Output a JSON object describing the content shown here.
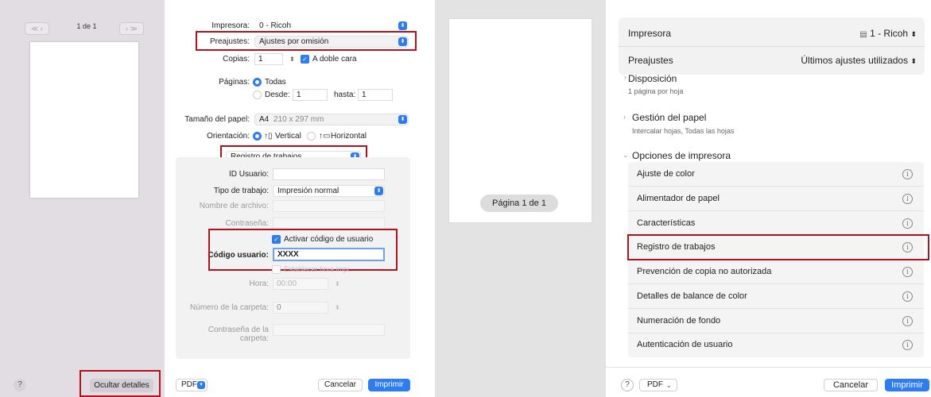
{
  "left_dialog": {
    "page_counter": "1 de 1",
    "printer": {
      "label": "Impresora:",
      "value": "0 - Ricoh"
    },
    "presets": {
      "label": "Preajustes:",
      "value": "Ajustes por omisión"
    },
    "copies": {
      "label": "Copias:",
      "value": "1",
      "two_sided_label": "A doble cara"
    },
    "pages": {
      "label": "Páginas:",
      "all_label": "Todas",
      "from_label": "Desde:",
      "from_value": "1",
      "to_label": "hasta:",
      "to_value": "1"
    },
    "paper_size": {
      "label": "Tamaño del papel:",
      "value": "A4",
      "dims": "210 x 297 mm"
    },
    "orientation": {
      "label": "Orientación:",
      "vertical": "Vertical",
      "horizontal": "Horizontal"
    },
    "section_popup": "Registro de trabajos",
    "job_log": {
      "user_id_label": "ID Usuario:",
      "job_type_label": "Tipo de trabajo:",
      "job_type_value": "Impresión normal",
      "file_name_label": "Nombre de archivo:",
      "password_label": "Contraseña:",
      "enable_user_code_label": "Activar código de usuario",
      "user_code_label": "Código usuario:",
      "user_code_value": "XXXX",
      "set_time_label": "Establecer hora impr.",
      "time_label": "Hora:",
      "time_value": "00:00",
      "folder_number_label": "Número de la carpeta:",
      "folder_number_value": "0",
      "folder_password_label": "Contraseña de la carpeta:"
    },
    "help_label": "?",
    "hide_details_label": "Ocultar detalles",
    "pdf_label": "PDF",
    "cancel_label": "Cancelar",
    "print_label": "Imprimir"
  },
  "right_dialog": {
    "page_pill": "Página 1 de 1",
    "printer": {
      "label": "Impresora",
      "value": "1 - Ricoh"
    },
    "presets": {
      "label": "Preajustes",
      "value": "Últimos ajustes utilizados"
    },
    "layout": {
      "title": "Disposición",
      "subtitle": "1 página por hoja"
    },
    "paper_handling": {
      "title": "Gestión del papel",
      "subtitle": "Intercalar hojas, Todas las hojas"
    },
    "printer_options": {
      "title": "Opciones de impresora"
    },
    "options": [
      {
        "label": "Ajuste de color"
      },
      {
        "label": "Alimentador de papel"
      },
      {
        "label": "Características"
      },
      {
        "label": "Registro de trabajos"
      },
      {
        "label": "Prevención de copia no autorizada"
      },
      {
        "label": "Detalles de balance de color"
      },
      {
        "label": "Numeración de fondo"
      },
      {
        "label": "Autenticación de usuario"
      }
    ],
    "help_label": "?",
    "pdf_label": "PDF",
    "cancel_label": "Cancelar",
    "print_label": "Imprimir"
  },
  "colors": {
    "accent": "#2b7cf5",
    "highlight": "#b3121c"
  }
}
